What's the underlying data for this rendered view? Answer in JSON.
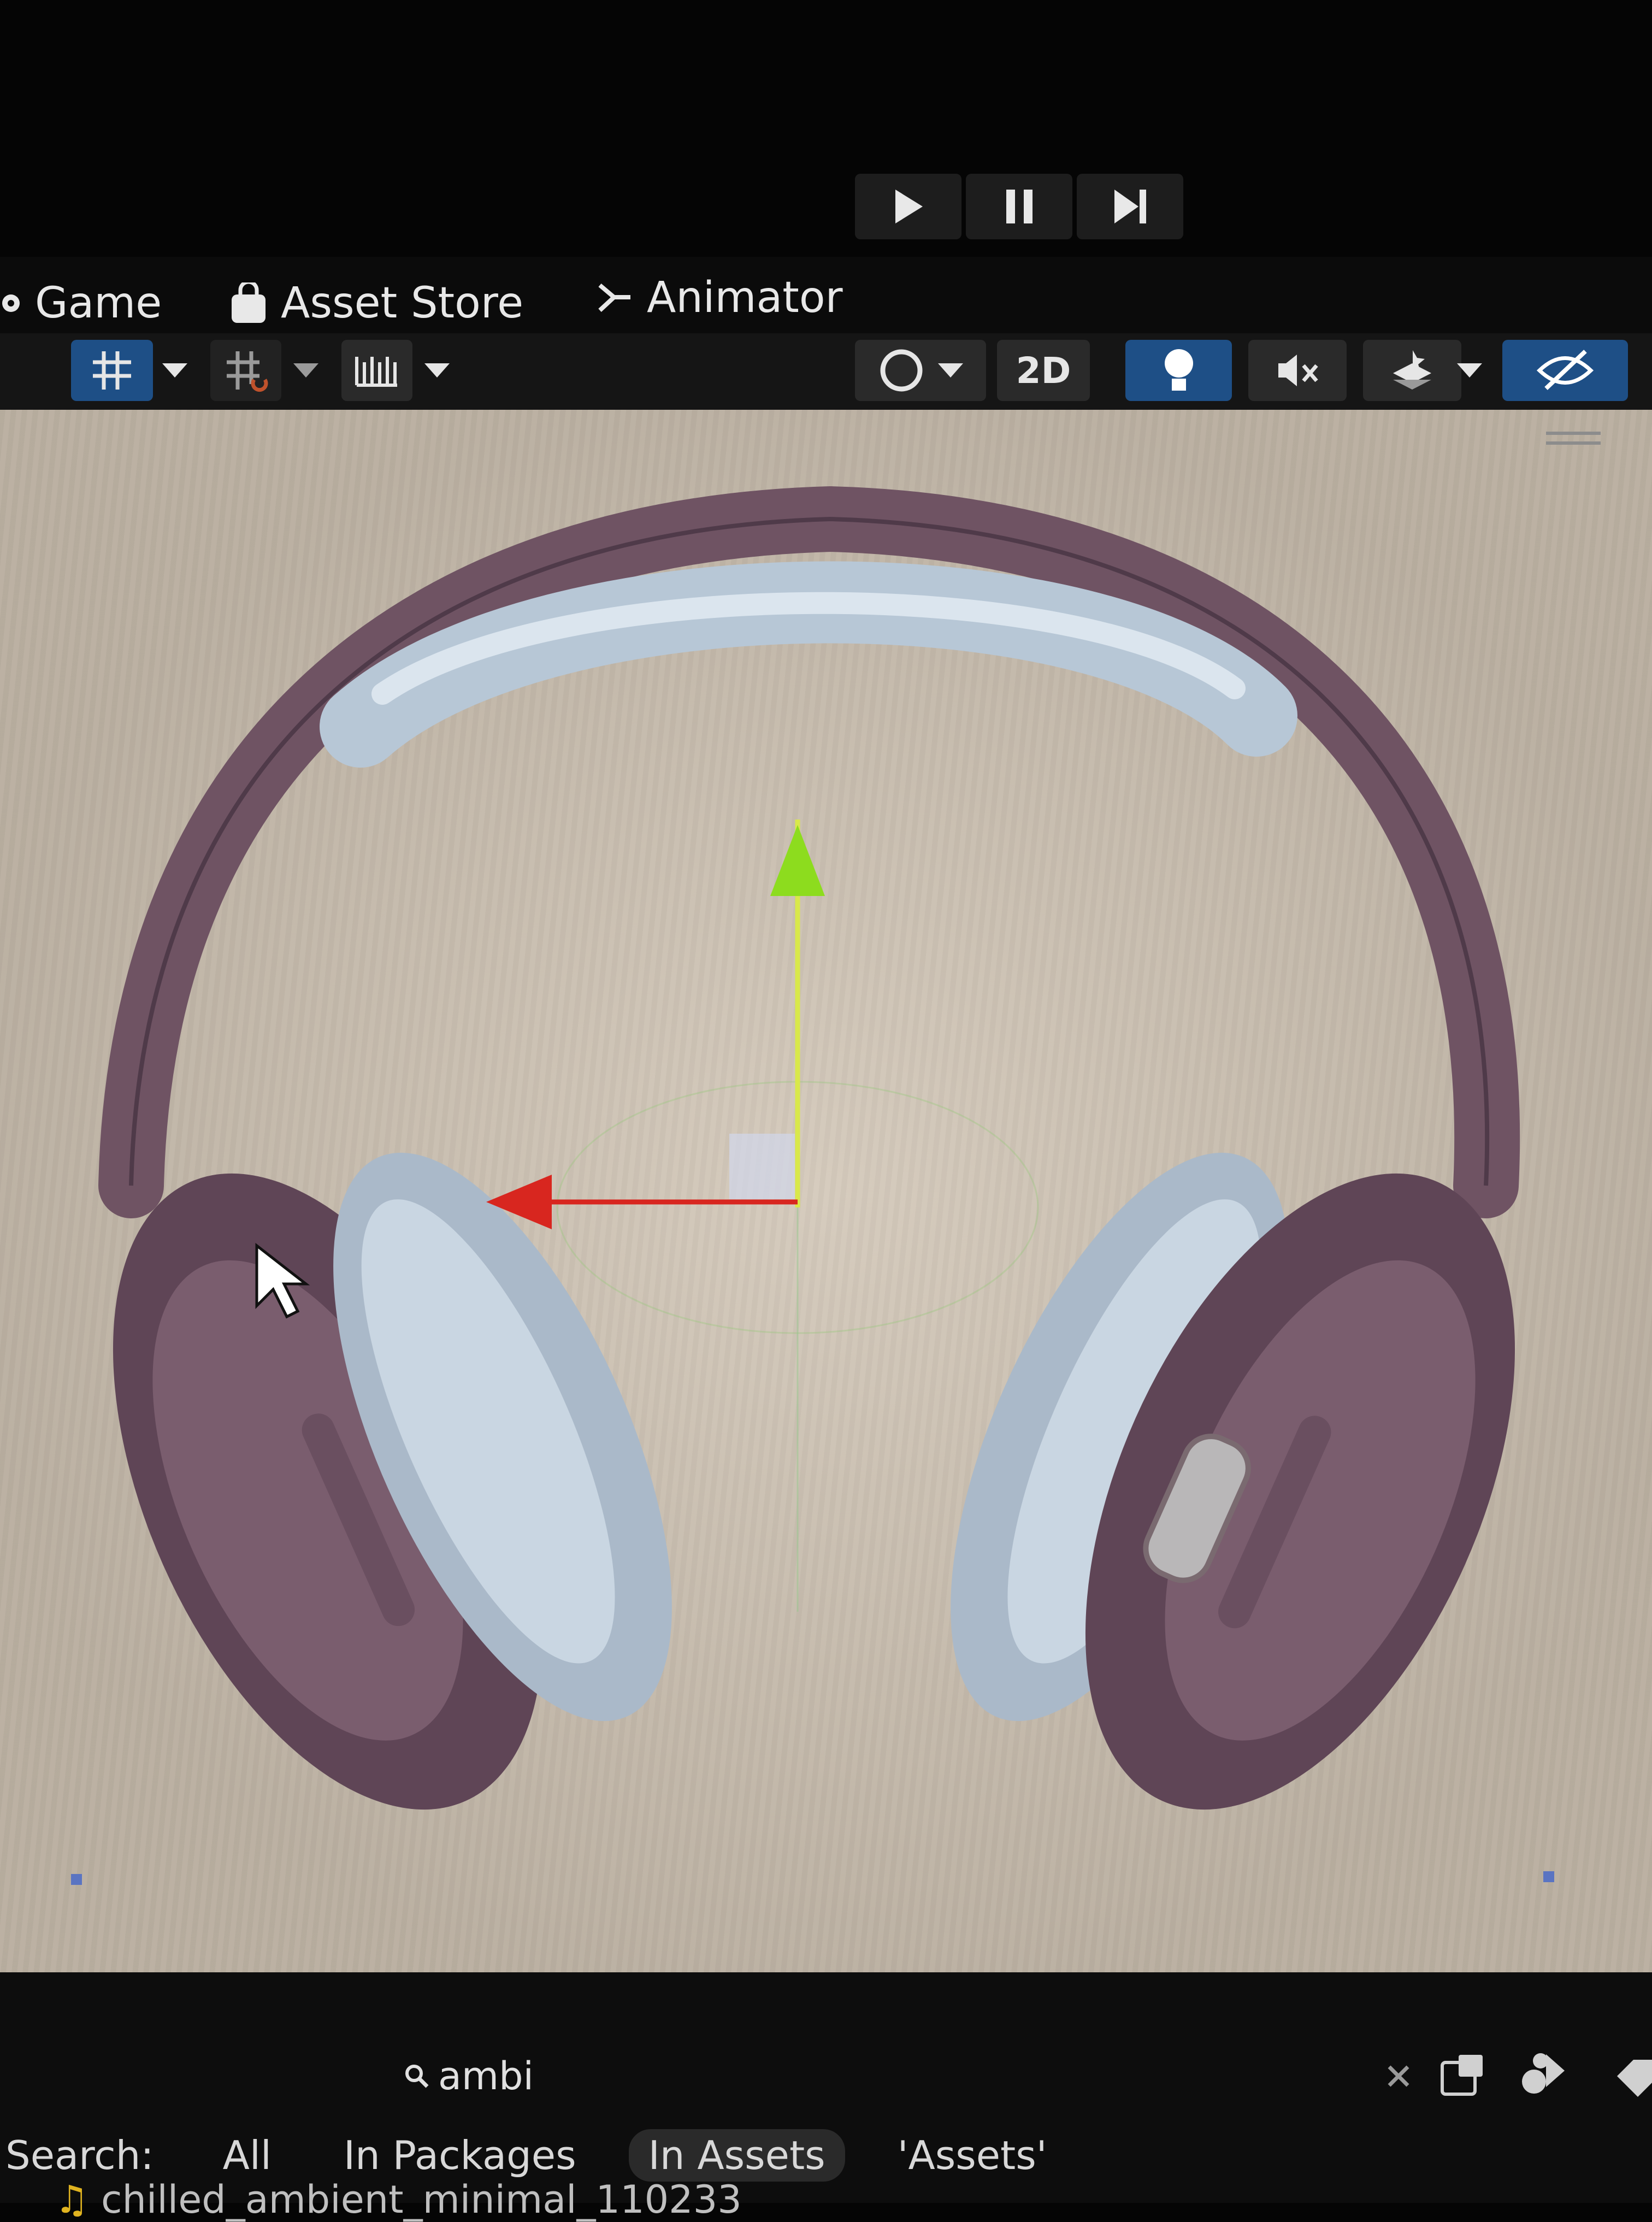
{
  "play_controls": {
    "play_icon": "play-icon",
    "pause_icon": "pause-icon",
    "step_icon": "step-forward-icon"
  },
  "tabs": [
    {
      "label": "Game",
      "icon": "game-controller-icon"
    },
    {
      "label": "Asset Store",
      "icon": "shopping-bag-icon"
    },
    {
      "label": "Animator",
      "icon": "animator-icon"
    }
  ],
  "toolbar": {
    "mode_2d_label": "2D",
    "icons": [
      "grid-snap-icon",
      "snap-increment-icon",
      "ruler-icon",
      "shading-mode-icon",
      "lighting-icon",
      "audio-mute-icon",
      "effects-icon",
      "hidden-visibility-icon"
    ]
  },
  "search": {
    "query": "ambi",
    "label": "Search:",
    "scopes": [
      "All",
      "In Packages",
      "In Assets",
      "'Assets'"
    ],
    "active_scope": "In Assets"
  },
  "asset_row": {
    "name": "chilled_ambient_minimal_110233"
  },
  "colors": {
    "scene_background": "#cfc3b3",
    "active_button": "#1e4f86",
    "axis_x": "#d8261f",
    "axis_y": "#8ddc1e"
  }
}
